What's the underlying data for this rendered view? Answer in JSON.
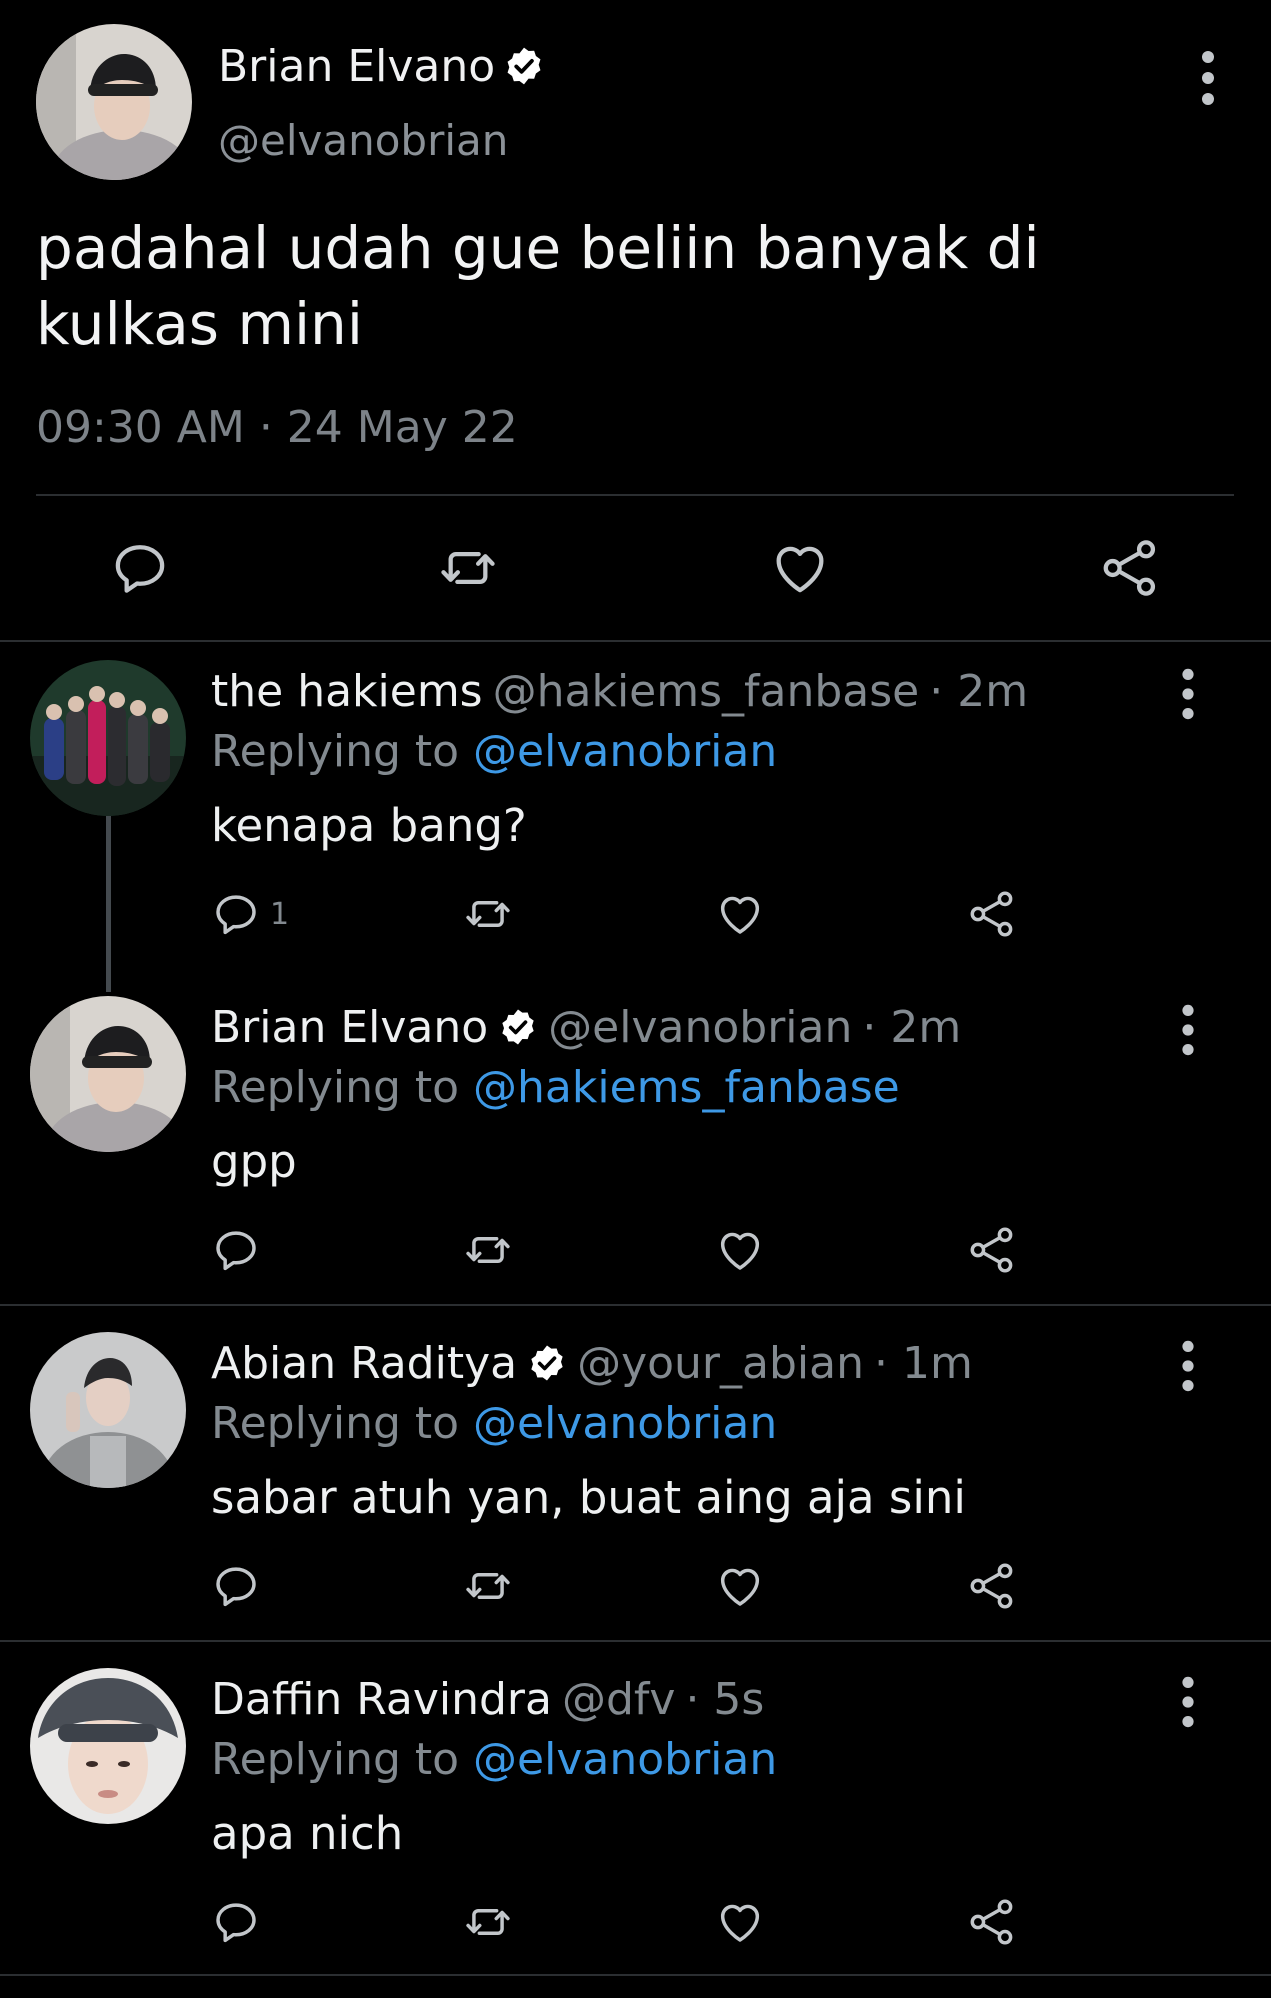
{
  "main_tweet": {
    "author_name": "Brian Elvano",
    "author_handle": "@elvanobrian",
    "verified": true,
    "text": "padahal udah gue beliin banyak di kulkas mini",
    "timestamp": "09:30 AM · 24 May 22",
    "actions": [
      "reply-icon",
      "retweet-icon",
      "like-icon",
      "share-icon"
    ]
  },
  "replies": [
    {
      "name": "the hakiems",
      "handle": "@hakiems_fanbase",
      "verified": false,
      "time": "· 2m",
      "replying_prefix": "Replying to ",
      "replying_to": "@elvanobrian",
      "text": "kenapa bang?",
      "reply_count": "1"
    },
    {
      "name": "Brian Elvano",
      "handle": "@elvanobrian",
      "verified": true,
      "time": "· 2m",
      "replying_prefix": "Replying to ",
      "replying_to": "@hakiems_fanbase",
      "text": "gpp",
      "reply_count": ""
    },
    {
      "name": "Abian Raditya",
      "handle": "@your_abian",
      "verified": true,
      "time": "· 1m",
      "replying_prefix": "Replying to ",
      "replying_to": "@elvanobrian",
      "text": "sabar atuh yan, buat aing aja sini",
      "reply_count": ""
    },
    {
      "name": "Daffin Ravindra",
      "handle": "@dfv",
      "verified": false,
      "time": "· 5s",
      "replying_prefix": "Replying to ",
      "replying_to": "@elvanobrian",
      "text": "apa nich",
      "reply_count": ""
    }
  ],
  "colors": {
    "background": "#000000",
    "text": "#e7e9ea",
    "secondary": "#838a90",
    "mention": "#3e99e6",
    "divider": "#2b2e31"
  }
}
